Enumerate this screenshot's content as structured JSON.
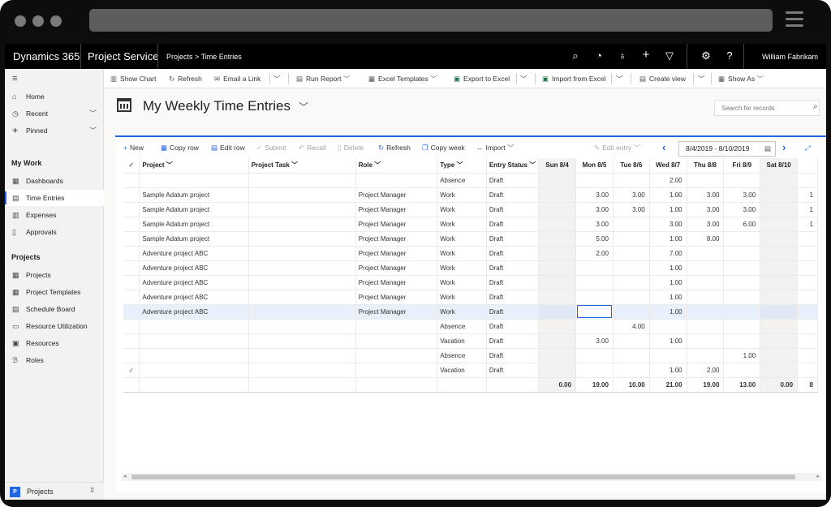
{
  "navbar": {
    "brand": "Dynamics 365",
    "app": "Project Service",
    "breadcrumb": "Projects  >  Time Entries",
    "user": "William Fabrikam"
  },
  "leftnav": {
    "menu_icon": "hamburger-icon",
    "items_top": [
      {
        "label": "Home",
        "icon": "home-icon"
      },
      {
        "label": "Recent",
        "icon": "clock-icon"
      },
      {
        "label": "Pinned",
        "icon": "pin-icon"
      }
    ],
    "section_mywork": "My Work",
    "mywork_items": [
      {
        "label": "Dashboards"
      },
      {
        "label": "Time Entries"
      },
      {
        "label": "Expenses"
      },
      {
        "label": "Approvals"
      }
    ],
    "section_projects": "Projects",
    "project_items": [
      {
        "label": "Projects"
      },
      {
        "label": "Project Templates"
      },
      {
        "label": "Schedule Board"
      },
      {
        "label": "Resource Utilization"
      },
      {
        "label": "Resources"
      },
      {
        "label": "Roles"
      }
    ],
    "footer": {
      "badge": "P",
      "label": "Projects"
    }
  },
  "commandbar": {
    "show_chart": "Show Chart",
    "refresh": "Refresh",
    "email_link": "Email a Link",
    "run_report": "Run Report",
    "excel_templates": "Excel Templates",
    "export_excel": "Export to Excel",
    "import_excel": "Import from Excel",
    "create_view": "Create view",
    "show_as": "Show As"
  },
  "page": {
    "title": "My Weekly Time Entries",
    "search_placeholder": "Search for records"
  },
  "gridtoolbar": {
    "new": "New",
    "copy_row": "Copy row",
    "edit_row": "Edit row",
    "submit": "Submit",
    "recall": "Recall",
    "delete": "Delete",
    "refresh": "Refresh",
    "copy_week": "Copy week",
    "import": "Import",
    "edit_entry": "Edit entry",
    "date_range": "8/4/2019 - 8/10/2019"
  },
  "grid": {
    "headers": {
      "project": "Project",
      "task": "Project Task",
      "role": "Role",
      "type": "Type",
      "status": "Entry Status",
      "days": [
        "Sun 8/4",
        "Mon 8/5",
        "Tue 8/6",
        "Wed 8/7",
        "Thu 8/8",
        "Fri 8/9",
        "Sat 8/10"
      ]
    },
    "rows": [
      {
        "project": "",
        "task": "",
        "role": "",
        "type": "Absence",
        "status": "Draft",
        "days": [
          "",
          "",
          "",
          "2.00",
          "",
          "",
          ""
        ],
        "extra": ""
      },
      {
        "project": "Sample Adatum project",
        "task": "",
        "role": "Project Manager",
        "type": "Work",
        "status": "Draft",
        "days": [
          "",
          "3.00",
          "3.00",
          "1.00",
          "3.00",
          "3.00",
          ""
        ],
        "extra": "1"
      },
      {
        "project": "Sample Adatum project",
        "task": "",
        "role": "Project Manager",
        "type": "Work",
        "status": "Draft",
        "days": [
          "",
          "3.00",
          "3.00",
          "1.00",
          "3.00",
          "3.00",
          ""
        ],
        "extra": "1"
      },
      {
        "project": "Sample Adatum project",
        "task": "",
        "role": "Project Manager",
        "type": "Work",
        "status": "Draft",
        "days": [
          "",
          "3.00",
          "",
          "3.00",
          "3.00",
          "6.00",
          ""
        ],
        "extra": "1"
      },
      {
        "project": "Sample Adatum project",
        "task": "",
        "role": "Project Manager",
        "type": "Work",
        "status": "Draft",
        "days": [
          "",
          "5.00",
          "",
          "1.00",
          "8.00",
          "",
          ""
        ],
        "extra": ""
      },
      {
        "project": "Adventure project ABC",
        "task": "",
        "role": "Project Manager",
        "type": "Work",
        "status": "Draft",
        "days": [
          "",
          "2.00",
          "",
          "7.00",
          "",
          "",
          ""
        ],
        "extra": ""
      },
      {
        "project": "Adventure project ABC",
        "task": "",
        "role": "Project Manager",
        "type": "Work",
        "status": "Draft",
        "days": [
          "",
          "",
          "",
          "1.00",
          "",
          "",
          ""
        ],
        "extra": ""
      },
      {
        "project": "Adventure project ABC",
        "task": "",
        "role": "Project Manager",
        "type": "Work",
        "status": "Draft",
        "days": [
          "",
          "",
          "",
          "1.00",
          "",
          "",
          ""
        ],
        "extra": ""
      },
      {
        "project": "Adventure project ABC",
        "task": "",
        "role": "Project Manager",
        "type": "Work",
        "status": "Draft",
        "days": [
          "",
          "",
          "",
          "1.00",
          "",
          "",
          ""
        ],
        "extra": ""
      },
      {
        "project": "Adventure project ABC",
        "task": "",
        "role": "Project Manager",
        "type": "Work",
        "status": "Draft",
        "days": [
          "",
          "",
          "",
          "1.00",
          "",
          "",
          ""
        ],
        "extra": "",
        "selected": true
      },
      {
        "project": "",
        "task": "",
        "role": "",
        "type": "Absence",
        "status": "Draft",
        "days": [
          "",
          "",
          "4.00",
          "",
          "",
          "",
          ""
        ],
        "extra": ""
      },
      {
        "project": "",
        "task": "",
        "role": "",
        "type": "Vacation",
        "status": "Draft",
        "days": [
          "",
          "3.00",
          "",
          "1.00",
          "",
          "",
          ""
        ],
        "extra": ""
      },
      {
        "project": "",
        "task": "",
        "role": "",
        "type": "Absence",
        "status": "Draft",
        "days": [
          "",
          "",
          "",
          "",
          "",
          "1.00",
          ""
        ],
        "extra": ""
      },
      {
        "project": "",
        "task": "",
        "role": "",
        "type": "Vacation",
        "status": "Draft",
        "days": [
          "",
          "",
          "",
          "1.00",
          "2.00",
          "",
          ""
        ],
        "extra": "",
        "checked": true
      }
    ],
    "totals": [
      "0.00",
      "19.00",
      "10.00",
      "21.00",
      "19.00",
      "13.00",
      "0.00"
    ],
    "totals_extra": "8"
  },
  "colors": {
    "accent": "#2266e3",
    "navbar": "#000000",
    "weekend": "#f3f2f1"
  }
}
